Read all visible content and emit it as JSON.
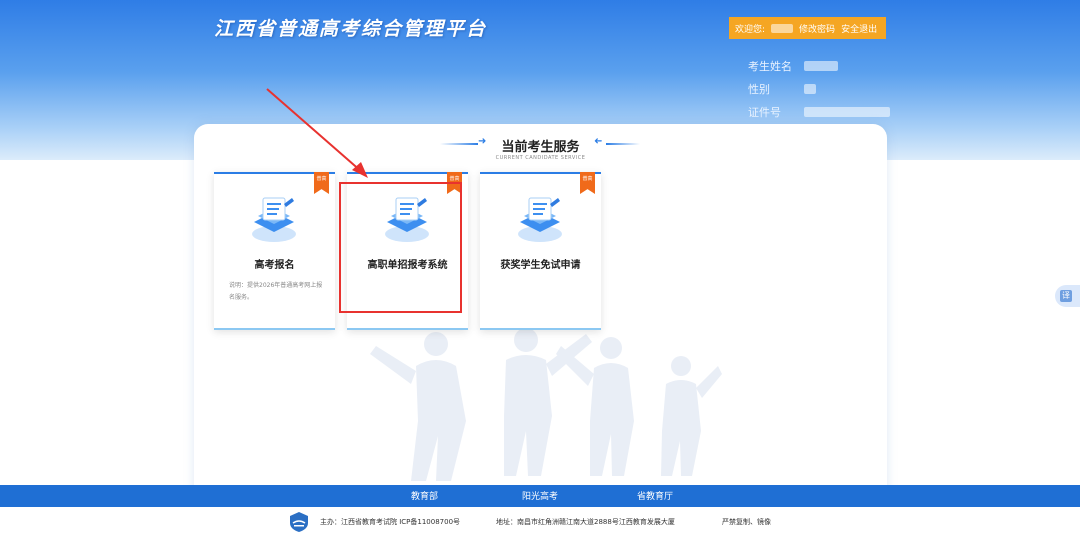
{
  "header": {
    "site_title": "江西省普通高考综合管理平台",
    "user_bar": {
      "welcome": "欢迎您:",
      "change_password": "修改密码",
      "logout": "安全退出"
    },
    "info": {
      "name_label": "考生姓名",
      "gender_label": "性别",
      "id_label": "证件号"
    }
  },
  "panel": {
    "title": "当前考生服务",
    "subtitle": "CURRENT CANDIDATE SERVICE"
  },
  "cards": [
    {
      "badge": "普高",
      "name": "高考报名",
      "desc": "说明：提供2026年普通高考网上报名服务。"
    },
    {
      "badge": "普高",
      "name": "高职单招报考系统",
      "desc": ""
    },
    {
      "badge": "普高",
      "name": "获奖学生免试申请",
      "desc": ""
    }
  ],
  "side_tool": {
    "label": "译"
  },
  "footer_nav": [
    "教育部",
    "阳光高考",
    "省教育厅"
  ],
  "footer": {
    "host": "主办：江西省教育考试院 ICP备11008700号",
    "address": "地址：南昌市红角洲赣江南大道2888号江西教育发展大厦",
    "notice": "严禁复制、镜像"
  },
  "colors": {
    "primary": "#2b7de5",
    "accent": "#f5a623",
    "badge": "#f06a1a",
    "highlight": "#e8322f",
    "footer_nav": "#1f6fd4"
  }
}
